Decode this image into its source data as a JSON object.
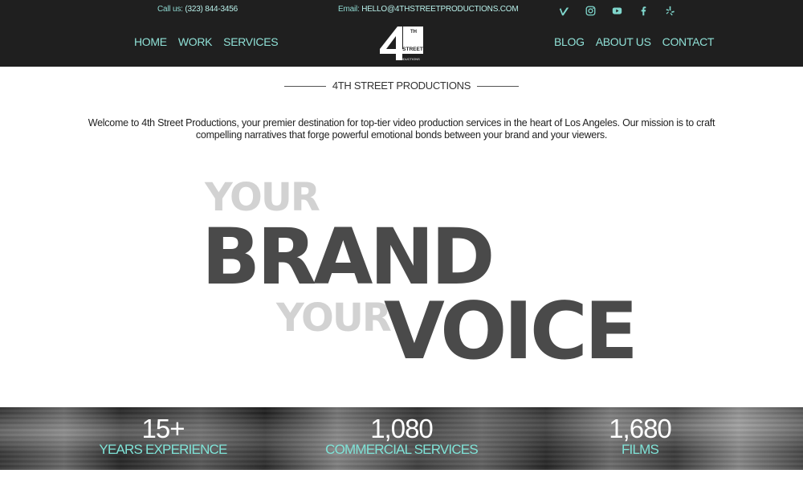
{
  "topbar": {
    "call_label": "Call us:",
    "call_value": "(323) 844-3456",
    "email_label": "Email:",
    "email_value": "HELLO@4THSTREETPRODUCTIONS.COM",
    "social": [
      "vimeo-icon",
      "instagram-icon",
      "youtube-icon",
      "facebook-icon",
      "yelp-icon"
    ]
  },
  "nav": {
    "left": [
      "HOME",
      "WORK",
      "SERVICES"
    ],
    "right": [
      "BLOG",
      "ABOUT US",
      "CONTACT"
    ]
  },
  "logo": {
    "mark": "4",
    "sup": "TH",
    "word": "STREET",
    "sub": "PRODUCTIONS"
  },
  "section": {
    "title": "4TH STREET PRODUCTIONS",
    "intro": "Welcome to 4th Street Productions, your premier destination for top-tier video production services in the heart of Los Angeles. Our mission is to craft compelling narratives that forge powerful emotional bonds between your brand and your viewers."
  },
  "hero": {
    "line1": "YOUR",
    "line2": "BRAND",
    "line3a": "YOUR",
    "line3b": "VOICE"
  },
  "stats": [
    {
      "number": "15+",
      "label": "YEARS EXPERIENCE"
    },
    {
      "number": "1,080",
      "label": "COMMERCIAL SERVICES"
    },
    {
      "number": "1,680",
      "label": "FILMS"
    }
  ],
  "colors": {
    "header_bg": "#1f1f1f",
    "accent": "#7fe3d7"
  }
}
